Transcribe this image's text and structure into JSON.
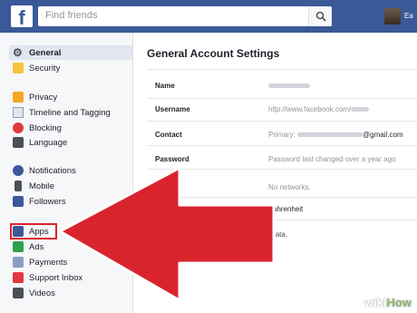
{
  "topbar": {
    "logo": "f",
    "search_placeholder": "Find friends",
    "user_name": "Ea"
  },
  "sidebar": {
    "items": [
      {
        "label": "General",
        "icon": "gear-icon",
        "active": true
      },
      {
        "label": "Security",
        "icon": "lock-icon"
      },
      {
        "label": "Privacy",
        "icon": "privacy-icon"
      },
      {
        "label": "Timeline and Tagging",
        "icon": "timeline-icon"
      },
      {
        "label": "Blocking",
        "icon": "block-icon"
      },
      {
        "label": "Language",
        "icon": "language-icon"
      },
      {
        "label": "Notifications",
        "icon": "notifications-icon"
      },
      {
        "label": "Mobile",
        "icon": "mobile-icon"
      },
      {
        "label": "Followers",
        "icon": "followers-icon"
      },
      {
        "label": "Apps",
        "icon": "apps-icon",
        "highlighted": true
      },
      {
        "label": "Ads",
        "icon": "ads-icon"
      },
      {
        "label": "Payments",
        "icon": "payments-icon"
      },
      {
        "label": "Support Inbox",
        "icon": "support-inbox-icon"
      },
      {
        "label": "Videos",
        "icon": "videos-icon"
      }
    ]
  },
  "main": {
    "title": "General Account Settings",
    "rows": [
      {
        "label": "Name",
        "value": ""
      },
      {
        "label": "Username",
        "value": "http://www.facebook.com/"
      },
      {
        "label": "Contact",
        "value": "Primary:",
        "value_suffix": "@gmail.com"
      },
      {
        "label": "Password",
        "value": "Password last changed over a year ago"
      },
      {
        "label": "Ne",
        "value": "No networks."
      },
      {
        "label": "ature",
        "value": "Fahrenheit"
      }
    ],
    "footer_note": "r Facebook data."
  },
  "watermark": {
    "wiki": "wiki",
    "how": "How"
  },
  "colors": {
    "brand": "#3b5998",
    "arrow": "#d9232d",
    "highlight": "#d9232d"
  }
}
